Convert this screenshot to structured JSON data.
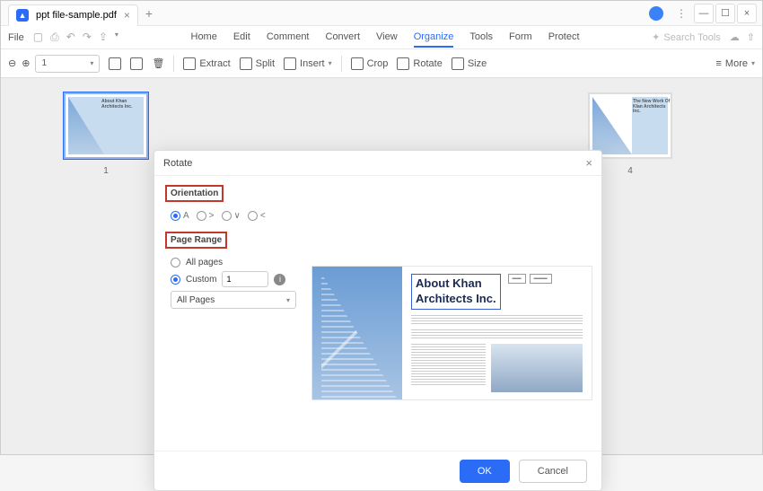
{
  "titlebar": {
    "filename": "ppt file-sample.pdf"
  },
  "menubar": {
    "file": "File",
    "tabs": [
      "Home",
      "Edit",
      "Comment",
      "Convert",
      "View",
      "Organize",
      "Tools",
      "Form",
      "Protect"
    ],
    "active_tab": "Organize",
    "search_placeholder": "Search Tools"
  },
  "toolbar": {
    "page_value": "1",
    "extract": "Extract",
    "split": "Split",
    "insert": "Insert",
    "crop": "Crop",
    "rotate": "Rotate",
    "size": "Size",
    "more": "More"
  },
  "thumbs": {
    "left_label": "1",
    "left_caption": "About Khan Architects Inc.",
    "right_label": "4",
    "right_caption": "The New Work Of Klan Architects Inc."
  },
  "dialog": {
    "title": "Rotate",
    "orientation": {
      "label": "Orientation",
      "options": [
        "A",
        ">",
        "∨",
        "<"
      ],
      "selected": "A"
    },
    "page_range": {
      "label": "Page Range",
      "all": "All pages",
      "custom": "Custom",
      "custom_value": "1",
      "select_value": "All Pages"
    },
    "preview": {
      "title1": "About Khan",
      "title2": "Architects Inc."
    },
    "ok": "OK",
    "cancel": "Cancel"
  }
}
